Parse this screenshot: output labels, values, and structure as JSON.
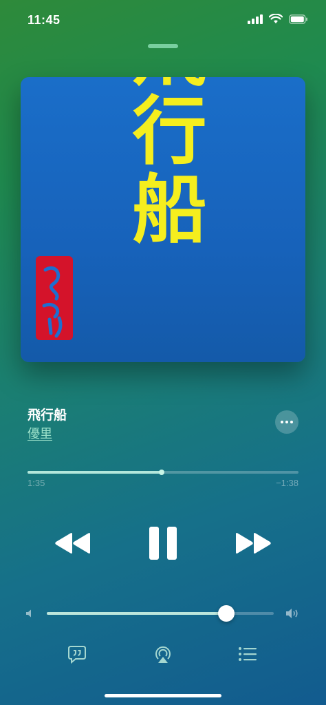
{
  "status": {
    "time": "11:45"
  },
  "artwork": {
    "title_lettering": "飛行船",
    "seal_lettering": "ゆうり"
  },
  "track": {
    "title": "飛行船",
    "artist": "優里"
  },
  "playback": {
    "elapsed": "1:35",
    "remaining": "−1:38",
    "progress": 0.496,
    "state": "playing"
  },
  "volume": {
    "level": 0.79
  },
  "icons": {
    "more": "ellipsis-icon",
    "rewind": "rewind-icon",
    "pause": "pause-icon",
    "forward": "fast-forward-icon",
    "volume_low": "speaker-low-icon",
    "volume_high": "speaker-high-icon",
    "lyrics": "lyrics-bubble-icon",
    "airplay": "airplay-icon",
    "queue": "queue-list-icon",
    "signal": "cellular-signal-icon",
    "wifi": "wifi-icon",
    "battery": "battery-icon"
  },
  "colors": {
    "accent": "#bdeee0",
    "artwork_bg": "#1767c0",
    "artwork_text": "#f5ee1e",
    "seal": "#d4132a"
  }
}
